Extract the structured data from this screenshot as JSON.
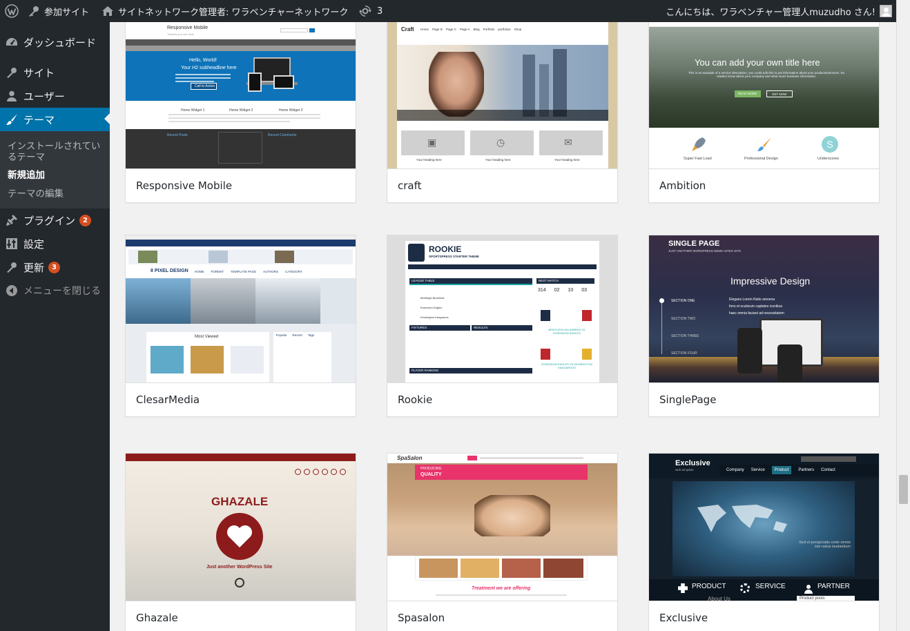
{
  "adminbar": {
    "my_sites": "参加サイト",
    "network_admin": "サイトネットワーク管理者: ワラベンチャーネットワーク",
    "updates_count": "3",
    "greeting": "こんにちは、ワラベンチャー管理人muzudho さん!"
  },
  "sidebar": {
    "dashboard": "ダッシュボード",
    "sites": "サイト",
    "users": "ユーザー",
    "themes": "テーマ",
    "installed_themes": "インストールされているテーマ",
    "add_new": "新規追加",
    "theme_editor": "テーマの編集",
    "plugins": "プラグイン",
    "plugins_badge": "2",
    "settings": "設定",
    "updates": "更新",
    "updates_badge": "3",
    "collapse": "メニューを閉じる"
  },
  "themes": [
    {
      "name": "Responsive Mobile"
    },
    {
      "name": "craft"
    },
    {
      "name": "Ambition"
    },
    {
      "name": "ClesarMedia"
    },
    {
      "name": "Rookie"
    },
    {
      "name": "SinglePage"
    },
    {
      "name": "Ghazale"
    },
    {
      "name": "Spasalon"
    },
    {
      "name": "Exclusive"
    }
  ],
  "shots": {
    "responsive": {
      "site_title": "Responsive Mobile",
      "tagline": "Themes you can trust",
      "hero_title": "Hello, World!",
      "hero_sub": "Your H2 subheadline here",
      "cta": "Call to Action",
      "widgets": [
        "Home Widget 1",
        "Home Widget 2",
        "Home Widget 3"
      ],
      "recent_posts": "Recent Posts",
      "recent_comments": "Recent Comments"
    },
    "craft": {
      "logo": "Craft",
      "nav": [
        "Home",
        "Page D",
        "Page C",
        "Page A",
        "Blog",
        "Portfolio",
        "portfolio2",
        "Shop"
      ],
      "headings": [
        "Your heading here",
        "Your heading here",
        "Your heading here"
      ]
    },
    "ambition": {
      "title": "You can add your own title here",
      "desc": "This is an example of a service description, you could edit this to put information about your products/services. So readers know about your company and what exact business information.",
      "btn1": "READ MORE",
      "btn2": "GET NOW",
      "features": [
        "Super Fast Load",
        "Professional Design",
        "Underscores"
      ]
    },
    "clesar": {
      "logo": "8 PIXEL DESIGN",
      "nav": [
        "HOME",
        "FORMAT",
        "TEMPLATE PAGE",
        "AUTHORS",
        "CATEGORY"
      ],
      "most_viewed": "Most Viewed",
      "tabs": [
        "Popular",
        "Recent",
        "Tags"
      ]
    },
    "rookie": {
      "title": "ROOKIE",
      "subtitle": "SPORTSPRESS STARTER THEME",
      "league_table": "LEAGUE TABLE",
      "next_match": "NEXT MATCH",
      "fixtures": "FIXTURES",
      "results": "RESULTS",
      "player_ranking": "PLAYER RANKING",
      "teams": [
        "Bentleigh Bluebirds",
        "Essendon Eagles",
        "Kensington Kangaroos"
      ],
      "countdown": [
        "314",
        "02",
        "10",
        "03"
      ],
      "match1": "BENTLEIGH BLUEBIRDS VS ESSENDON EAGLES",
      "match2": "ESSENDON EAGLES VS KENSINGTON KANGAROOS"
    },
    "singlepage": {
      "title": "SINGLE PAGE",
      "subtitle": "JUST ANOTHER WORDPRESS DEMO SITES SITE",
      "headline": "Impressive Design",
      "sections": [
        "SECTION ONE",
        "SECTION TWO",
        "SECTION THREE",
        "SECTION FOUR"
      ],
      "bullets": [
        "Elegans Lorem Ratio amoena",
        "fons et oculorum captates iconibus",
        "haec omnia faciant ad necessitatem"
      ]
    },
    "ghazale": {
      "title": "GHAZALE",
      "tagline": "Just another WordPress Site"
    },
    "spasalon": {
      "logo": "SpaSalon",
      "badge_top": "PRODUCING",
      "badge_bottom": "QUALITY",
      "offering": "Treatment we are offering"
    },
    "exclusive": {
      "title": "Exclusive",
      "subtitle": "web template",
      "nav": [
        "Company",
        "Service",
        "Product",
        "Partners",
        "Contact"
      ],
      "quote": "Sed ut perspiciatis unde omnis iste natus laudantium",
      "features": [
        "PRODUCT",
        "SERVICE",
        "PARTNER"
      ],
      "about": "About Us",
      "product_posts": "Product posts"
    }
  },
  "colors": {
    "adminbar": "#23282d",
    "menu_current": "#0073aa",
    "badge": "#d54e21",
    "content_bg": "#f1f1f1"
  }
}
